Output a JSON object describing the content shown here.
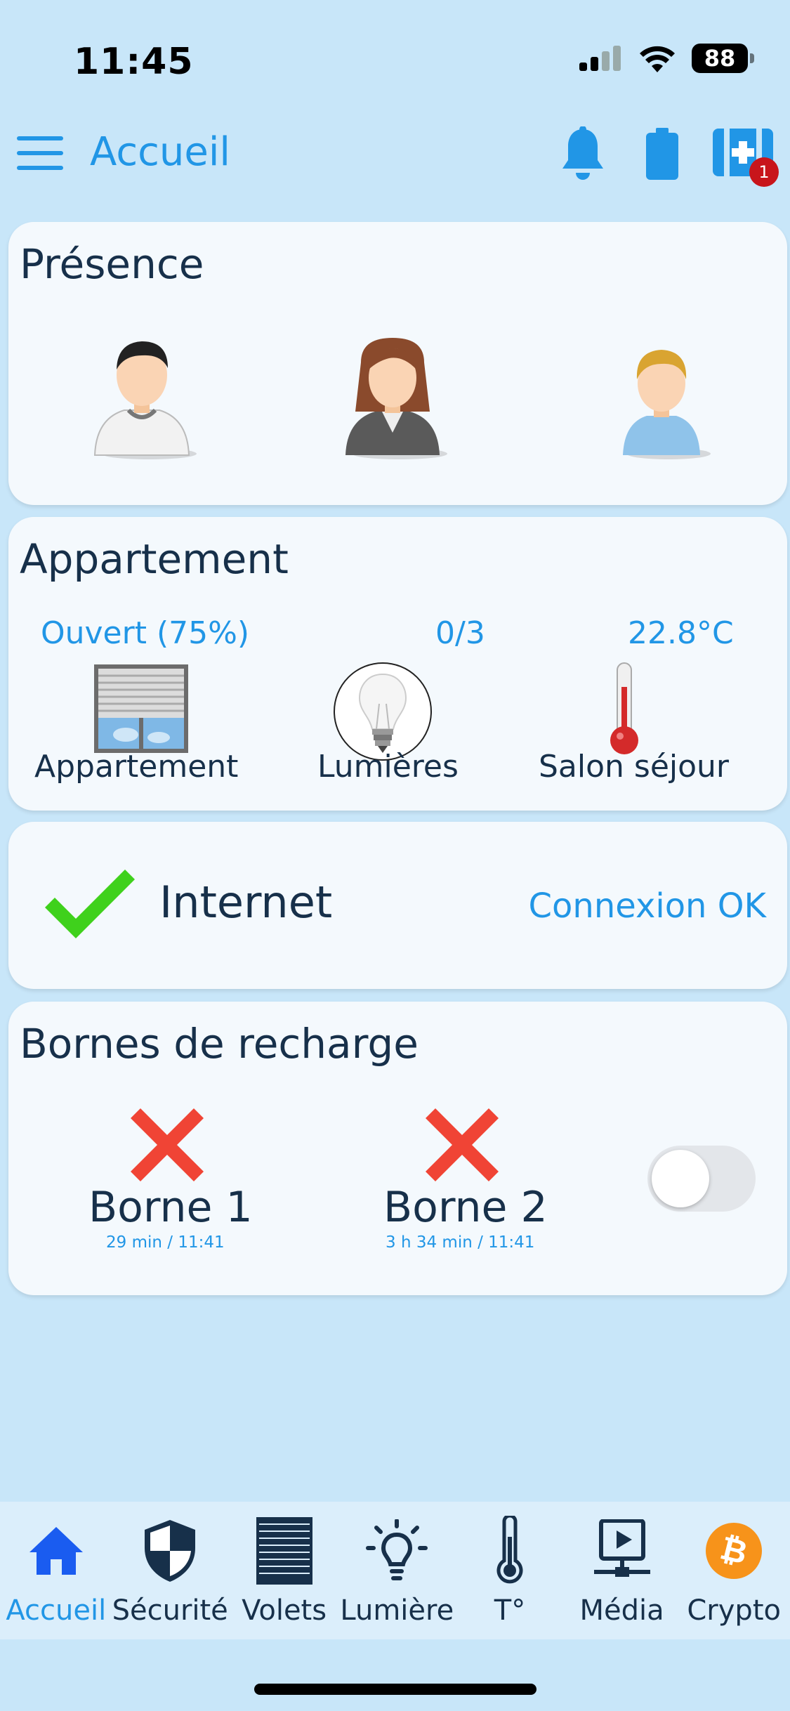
{
  "status_bar": {
    "time": "11:45",
    "battery": "88"
  },
  "header": {
    "title": "Accueil",
    "notification_badge": "1"
  },
  "presence": {
    "title": "Présence"
  },
  "appartement": {
    "title": "Appartement",
    "items": [
      {
        "value": "Ouvert (75%)",
        "label": "Appartement",
        "icon": "shutter-window-icon"
      },
      {
        "value": "0/3",
        "label": "Lumières",
        "icon": "light-bulb-icon"
      },
      {
        "value": "22.8°C",
        "label": "Salon séjour",
        "icon": "thermometer-icon"
      }
    ]
  },
  "internet": {
    "title": "Internet",
    "status": "Connexion OK"
  },
  "bornes": {
    "title": "Bornes de recharge",
    "items": [
      {
        "name": "Borne 1",
        "detail": "29 min / 11:41"
      },
      {
        "name": "Borne 2",
        "detail": "3 h 34 min / 11:41"
      }
    ],
    "toggle_on": false
  },
  "nav": [
    {
      "label": "Accueil",
      "icon": "home-icon",
      "active": true
    },
    {
      "label": "Sécurité",
      "icon": "shield-icon"
    },
    {
      "label": "Volets",
      "icon": "shutter-icon"
    },
    {
      "label": "Lumière",
      "icon": "bulb-icon"
    },
    {
      "label": "T°",
      "icon": "thermometer-icon"
    },
    {
      "label": "Média",
      "icon": "media-icon"
    },
    {
      "label": "Crypto",
      "icon": "bitcoin-icon"
    }
  ],
  "colors": {
    "accent": "#2196e6",
    "background": "#c8e6f9",
    "card": "#f4f9fd",
    "ok": "#3fd11c",
    "error": "#f04435",
    "badge": "#c8151b"
  }
}
